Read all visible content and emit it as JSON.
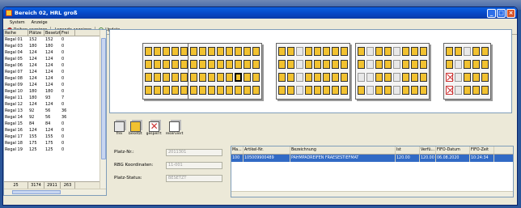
{
  "window": {
    "title": "Bereich 02, HRL groß"
  },
  "menu": [
    "System",
    "Anzeige"
  ],
  "toolbar": {
    "rows_label": "Reihen anzeigen",
    "legend_label": "Legende anzeigen",
    "update_label": "Update"
  },
  "table": {
    "columns": [
      "Reihe",
      "Plätze",
      "Besetzt",
      "Frei"
    ],
    "rows": [
      [
        "Regal 01",
        "152",
        "152",
        "0"
      ],
      [
        "Regal 03",
        "180",
        "180",
        "0"
      ],
      [
        "Regal 04",
        "124",
        "124",
        "0"
      ],
      [
        "Regal 05",
        "124",
        "124",
        "0"
      ],
      [
        "Regal 06",
        "124",
        "124",
        "0"
      ],
      [
        "Regal 07",
        "124",
        "124",
        "0"
      ],
      [
        "Regal 08",
        "124",
        "124",
        "0"
      ],
      [
        "Regal 09",
        "124",
        "124",
        "0"
      ],
      [
        "Regal 10",
        "180",
        "180",
        "0"
      ],
      [
        "Regal 11",
        "180",
        "93",
        "7"
      ],
      [
        "Regal 12",
        "124",
        "124",
        "0"
      ],
      [
        "Regal 13",
        "92",
        "56",
        "36"
      ],
      [
        "Regal 14",
        "92",
        "56",
        "36"
      ],
      [
        "Regal 15",
        "84",
        "84",
        "0"
      ],
      [
        "Regal 16",
        "124",
        "124",
        "0"
      ],
      [
        "Regal 17",
        "155",
        "155",
        "0"
      ],
      [
        "Regal 18",
        "175",
        "175",
        "0"
      ],
      [
        "Regal 19",
        "125",
        "125",
        "0"
      ]
    ],
    "footer": [
      "25",
      "3174",
      "2911",
      "263"
    ]
  },
  "legend": {
    "items": [
      "frei",
      "besetzt",
      "gesperrt",
      "reserviert"
    ]
  },
  "form": {
    "platz_nr_label": "Platz-Nr.:",
    "platz_nr_value": "2011301",
    "rbg_label": "RBG Koordinaten:",
    "rbg_value": "11-001",
    "status_label": "Platz-Status:",
    "status_value": "BESETZT"
  },
  "detail": {
    "columns": [
      "Ma...",
      "Artikel-Nr.",
      "Bezeichnung",
      "Ist",
      "Verfü...",
      "FIFO-Datum",
      "FIFO-Zeit"
    ],
    "rows": [
      [
        "100",
        "105009900489",
        "PAHMPADREIFEN FRAESESTIEFMAT",
        "120.00",
        "120.00",
        "06.08.2020",
        "10:24:34"
      ]
    ]
  },
  "colors": {
    "occupied": "#f2c230",
    "free": "#e8e8e8",
    "blocked": "#cc3333",
    "selection": "#316ac5"
  }
}
